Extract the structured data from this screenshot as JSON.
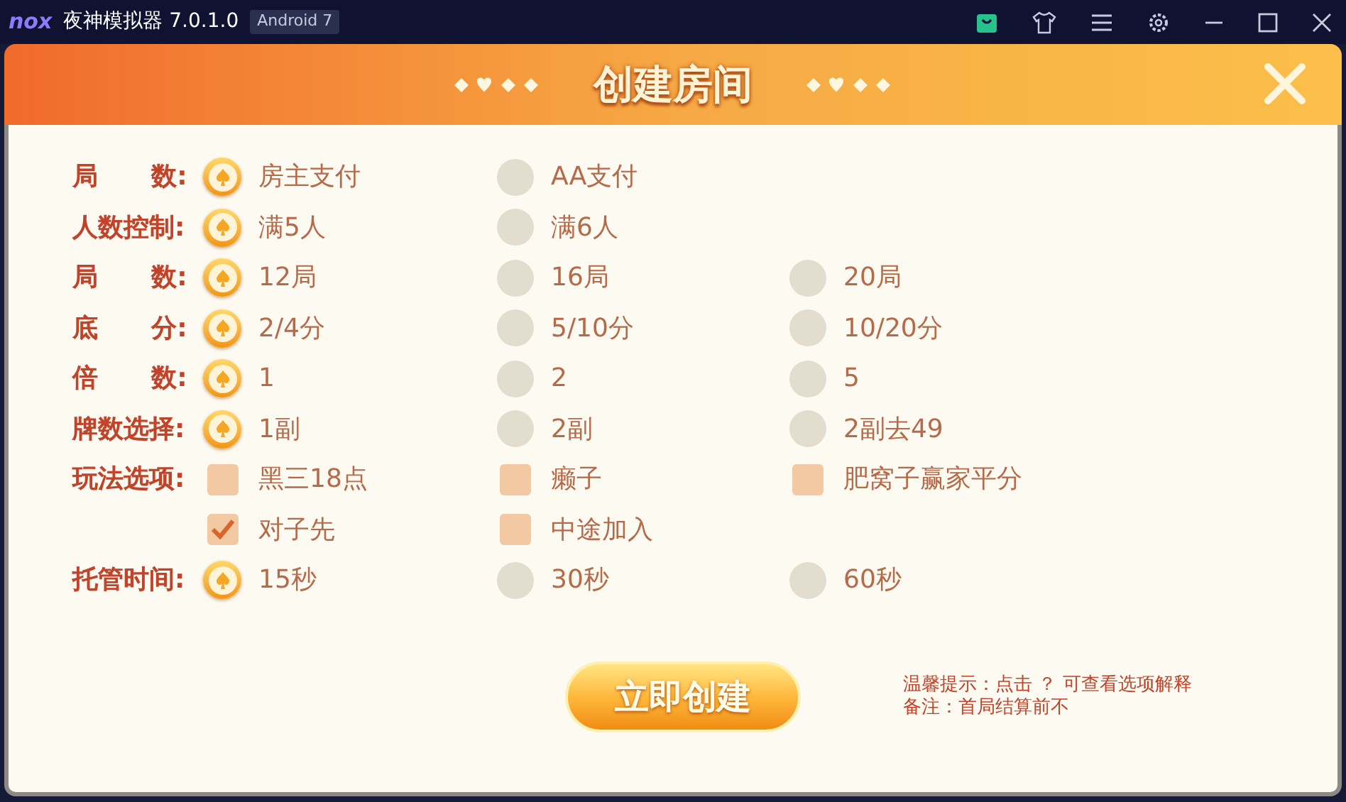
{
  "window": {
    "logo": "nox",
    "title": "夜神模拟器 7.0.1.0",
    "badge": "Android 7"
  },
  "dialog": {
    "title": "创建房间"
  },
  "rows": [
    {
      "label": "局      数:",
      "options": [
        {
          "kind": "radio",
          "label": "房主支付",
          "selected": true
        },
        {
          "kind": "radio",
          "label": "AA支付",
          "selected": false
        }
      ]
    },
    {
      "label": "人数控制:",
      "options": [
        {
          "kind": "radio",
          "label": "满5人",
          "selected": true
        },
        {
          "kind": "radio",
          "label": "满6人",
          "selected": false
        }
      ]
    },
    {
      "label": "局      数:",
      "options": [
        {
          "kind": "radio",
          "label": "12局",
          "selected": true
        },
        {
          "kind": "radio",
          "label": "16局",
          "selected": false
        },
        {
          "kind": "radio",
          "label": "20局",
          "selected": false
        }
      ]
    },
    {
      "label": "底      分:",
      "options": [
        {
          "kind": "radio",
          "label": "2/4分",
          "selected": true
        },
        {
          "kind": "radio",
          "label": "5/10分",
          "selected": false
        },
        {
          "kind": "radio",
          "label": "10/20分",
          "selected": false
        }
      ]
    },
    {
      "label": "倍      数:",
      "options": [
        {
          "kind": "radio",
          "label": "1",
          "selected": true
        },
        {
          "kind": "radio",
          "label": "2",
          "selected": false
        },
        {
          "kind": "radio",
          "label": "5",
          "selected": false
        }
      ]
    },
    {
      "label": "牌数选择:",
      "options": [
        {
          "kind": "radio",
          "label": "1副",
          "selected": true
        },
        {
          "kind": "radio",
          "label": "2副",
          "selected": false
        },
        {
          "kind": "radio",
          "label": "2副去49",
          "selected": false
        }
      ]
    },
    {
      "label": "玩法选项:",
      "options": [
        {
          "kind": "checkbox",
          "label": "黑三18点",
          "checked": false
        },
        {
          "kind": "checkbox",
          "label": "癞子",
          "checked": false
        },
        {
          "kind": "checkbox",
          "label": "肥窝子赢家平分",
          "checked": false
        }
      ]
    },
    {
      "options": [
        {
          "kind": "checkbox",
          "label": "对子先",
          "checked": true
        },
        {
          "kind": "checkbox",
          "label": "中途加入",
          "checked": false
        }
      ]
    },
    {
      "label": "托管时间:",
      "options": [
        {
          "kind": "radio",
          "label": "15秒",
          "selected": true
        },
        {
          "kind": "radio",
          "label": "30秒",
          "selected": false
        },
        {
          "kind": "radio",
          "label": "60秒",
          "selected": false
        }
      ]
    }
  ],
  "create_button": "立即创建",
  "notes": [
    "温馨提示：点击 ？ 可查看选项解释",
    "备注：首局结算前不"
  ]
}
